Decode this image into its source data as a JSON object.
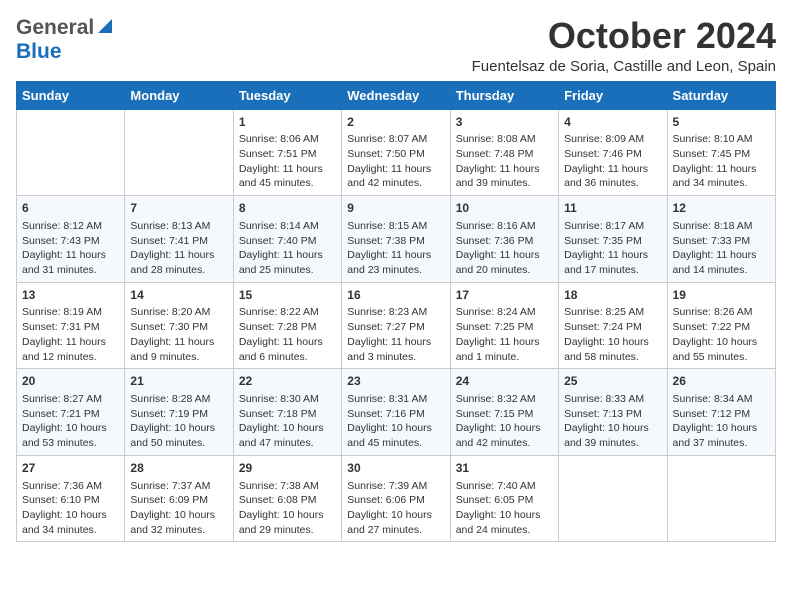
{
  "header": {
    "logo_general": "General",
    "logo_blue": "Blue",
    "month_title": "October 2024",
    "subtitle": "Fuentelsaz de Soria, Castille and Leon, Spain"
  },
  "days_of_week": [
    "Sunday",
    "Monday",
    "Tuesday",
    "Wednesday",
    "Thursday",
    "Friday",
    "Saturday"
  ],
  "weeks": [
    [
      {
        "num": "",
        "sunrise": "",
        "sunset": "",
        "daylight": ""
      },
      {
        "num": "",
        "sunrise": "",
        "sunset": "",
        "daylight": ""
      },
      {
        "num": "1",
        "sunrise": "Sunrise: 8:06 AM",
        "sunset": "Sunset: 7:51 PM",
        "daylight": "Daylight: 11 hours and 45 minutes."
      },
      {
        "num": "2",
        "sunrise": "Sunrise: 8:07 AM",
        "sunset": "Sunset: 7:50 PM",
        "daylight": "Daylight: 11 hours and 42 minutes."
      },
      {
        "num": "3",
        "sunrise": "Sunrise: 8:08 AM",
        "sunset": "Sunset: 7:48 PM",
        "daylight": "Daylight: 11 hours and 39 minutes."
      },
      {
        "num": "4",
        "sunrise": "Sunrise: 8:09 AM",
        "sunset": "Sunset: 7:46 PM",
        "daylight": "Daylight: 11 hours and 36 minutes."
      },
      {
        "num": "5",
        "sunrise": "Sunrise: 8:10 AM",
        "sunset": "Sunset: 7:45 PM",
        "daylight": "Daylight: 11 hours and 34 minutes."
      }
    ],
    [
      {
        "num": "6",
        "sunrise": "Sunrise: 8:12 AM",
        "sunset": "Sunset: 7:43 PM",
        "daylight": "Daylight: 11 hours and 31 minutes."
      },
      {
        "num": "7",
        "sunrise": "Sunrise: 8:13 AM",
        "sunset": "Sunset: 7:41 PM",
        "daylight": "Daylight: 11 hours and 28 minutes."
      },
      {
        "num": "8",
        "sunrise": "Sunrise: 8:14 AM",
        "sunset": "Sunset: 7:40 PM",
        "daylight": "Daylight: 11 hours and 25 minutes."
      },
      {
        "num": "9",
        "sunrise": "Sunrise: 8:15 AM",
        "sunset": "Sunset: 7:38 PM",
        "daylight": "Daylight: 11 hours and 23 minutes."
      },
      {
        "num": "10",
        "sunrise": "Sunrise: 8:16 AM",
        "sunset": "Sunset: 7:36 PM",
        "daylight": "Daylight: 11 hours and 20 minutes."
      },
      {
        "num": "11",
        "sunrise": "Sunrise: 8:17 AM",
        "sunset": "Sunset: 7:35 PM",
        "daylight": "Daylight: 11 hours and 17 minutes."
      },
      {
        "num": "12",
        "sunrise": "Sunrise: 8:18 AM",
        "sunset": "Sunset: 7:33 PM",
        "daylight": "Daylight: 11 hours and 14 minutes."
      }
    ],
    [
      {
        "num": "13",
        "sunrise": "Sunrise: 8:19 AM",
        "sunset": "Sunset: 7:31 PM",
        "daylight": "Daylight: 11 hours and 12 minutes."
      },
      {
        "num": "14",
        "sunrise": "Sunrise: 8:20 AM",
        "sunset": "Sunset: 7:30 PM",
        "daylight": "Daylight: 11 hours and 9 minutes."
      },
      {
        "num": "15",
        "sunrise": "Sunrise: 8:22 AM",
        "sunset": "Sunset: 7:28 PM",
        "daylight": "Daylight: 11 hours and 6 minutes."
      },
      {
        "num": "16",
        "sunrise": "Sunrise: 8:23 AM",
        "sunset": "Sunset: 7:27 PM",
        "daylight": "Daylight: 11 hours and 3 minutes."
      },
      {
        "num": "17",
        "sunrise": "Sunrise: 8:24 AM",
        "sunset": "Sunset: 7:25 PM",
        "daylight": "Daylight: 11 hours and 1 minute."
      },
      {
        "num": "18",
        "sunrise": "Sunrise: 8:25 AM",
        "sunset": "Sunset: 7:24 PM",
        "daylight": "Daylight: 10 hours and 58 minutes."
      },
      {
        "num": "19",
        "sunrise": "Sunrise: 8:26 AM",
        "sunset": "Sunset: 7:22 PM",
        "daylight": "Daylight: 10 hours and 55 minutes."
      }
    ],
    [
      {
        "num": "20",
        "sunrise": "Sunrise: 8:27 AM",
        "sunset": "Sunset: 7:21 PM",
        "daylight": "Daylight: 10 hours and 53 minutes."
      },
      {
        "num": "21",
        "sunrise": "Sunrise: 8:28 AM",
        "sunset": "Sunset: 7:19 PM",
        "daylight": "Daylight: 10 hours and 50 minutes."
      },
      {
        "num": "22",
        "sunrise": "Sunrise: 8:30 AM",
        "sunset": "Sunset: 7:18 PM",
        "daylight": "Daylight: 10 hours and 47 minutes."
      },
      {
        "num": "23",
        "sunrise": "Sunrise: 8:31 AM",
        "sunset": "Sunset: 7:16 PM",
        "daylight": "Daylight: 10 hours and 45 minutes."
      },
      {
        "num": "24",
        "sunrise": "Sunrise: 8:32 AM",
        "sunset": "Sunset: 7:15 PM",
        "daylight": "Daylight: 10 hours and 42 minutes."
      },
      {
        "num": "25",
        "sunrise": "Sunrise: 8:33 AM",
        "sunset": "Sunset: 7:13 PM",
        "daylight": "Daylight: 10 hours and 39 minutes."
      },
      {
        "num": "26",
        "sunrise": "Sunrise: 8:34 AM",
        "sunset": "Sunset: 7:12 PM",
        "daylight": "Daylight: 10 hours and 37 minutes."
      }
    ],
    [
      {
        "num": "27",
        "sunrise": "Sunrise: 7:36 AM",
        "sunset": "Sunset: 6:10 PM",
        "daylight": "Daylight: 10 hours and 34 minutes."
      },
      {
        "num": "28",
        "sunrise": "Sunrise: 7:37 AM",
        "sunset": "Sunset: 6:09 PM",
        "daylight": "Daylight: 10 hours and 32 minutes."
      },
      {
        "num": "29",
        "sunrise": "Sunrise: 7:38 AM",
        "sunset": "Sunset: 6:08 PM",
        "daylight": "Daylight: 10 hours and 29 minutes."
      },
      {
        "num": "30",
        "sunrise": "Sunrise: 7:39 AM",
        "sunset": "Sunset: 6:06 PM",
        "daylight": "Daylight: 10 hours and 27 minutes."
      },
      {
        "num": "31",
        "sunrise": "Sunrise: 7:40 AM",
        "sunset": "Sunset: 6:05 PM",
        "daylight": "Daylight: 10 hours and 24 minutes."
      },
      {
        "num": "",
        "sunrise": "",
        "sunset": "",
        "daylight": ""
      },
      {
        "num": "",
        "sunrise": "",
        "sunset": "",
        "daylight": ""
      }
    ]
  ]
}
